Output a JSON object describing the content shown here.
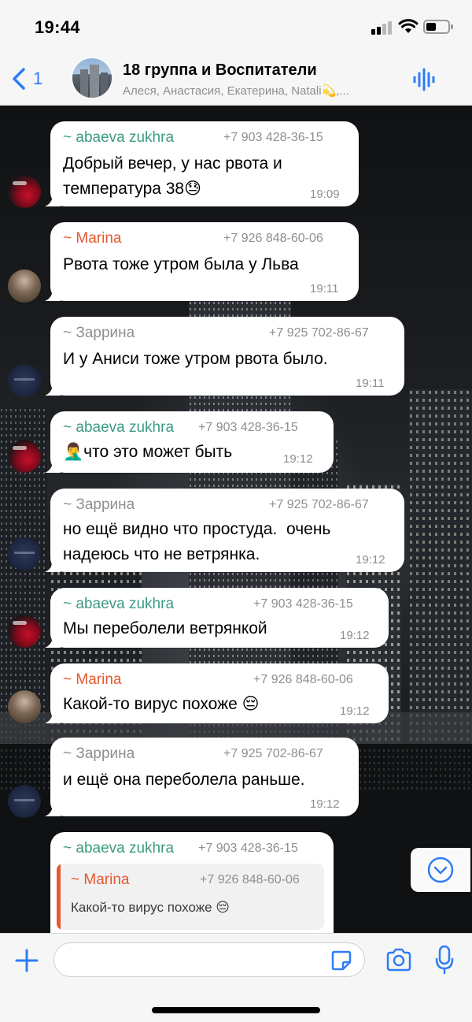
{
  "status_bar": {
    "time": "19:44"
  },
  "header": {
    "back_count": "1",
    "title": "18 группа и Воспитатели",
    "subtitle": "Алеся, Анастасия, Екатерина, Natali💫,..."
  },
  "messages": [
    {
      "sender": "~ abaeva zukhra",
      "phone": "+7 903 428-36-15",
      "text": "Добрый вечер, у нас рвота и\nтемпература 38😓",
      "time": "19:09"
    },
    {
      "sender": "~ Marina",
      "phone": "+7 926 848-60-06",
      "text": "Рвота тоже утром была у Льва",
      "time": "19:11"
    },
    {
      "sender": "~ Заррина",
      "phone": "+7 925 702-86-67",
      "text": "И у Аниси тоже утром рвота было.",
      "time": "19:11"
    },
    {
      "sender": "~ abaeva zukhra",
      "phone": "+7 903 428-36-15",
      "text": "🤦‍♂️что это может быть",
      "time": "19:12"
    },
    {
      "sender": "~ Заррина",
      "phone": "+7 925 702-86-67",
      "text": "но ещё видно что простуда.  очень\nнадеюсь что не ветрянка.",
      "time": "19:12"
    },
    {
      "sender": "~ abaeva zukhra",
      "phone": "+7 903 428-36-15",
      "text": "Мы переболели ветрянкой",
      "time": "19:12"
    },
    {
      "sender": "~ Marina",
      "phone": "+7 926 848-60-06",
      "text": "Какой-то вирус похоже 😔",
      "time": "19:12"
    },
    {
      "sender": "~ Заррина",
      "phone": "+7 925 702-86-67",
      "text": "и ещё она переболела раньше.",
      "time": "19:12"
    },
    {
      "sender": "~ abaeva zukhra",
      "phone": "+7 903 428-36-15",
      "quote": {
        "sender": "~ Marina",
        "phone": "+7 926 848-60-06",
        "text": "Какой-то вирус похоже 😔"
      }
    }
  ],
  "input": {
    "placeholder": ""
  },
  "colors": {
    "accent": "#2f7cf6",
    "sender_green": "#3d9b82",
    "sender_red": "#e5582f",
    "sender_gray": "#8e8e93"
  }
}
